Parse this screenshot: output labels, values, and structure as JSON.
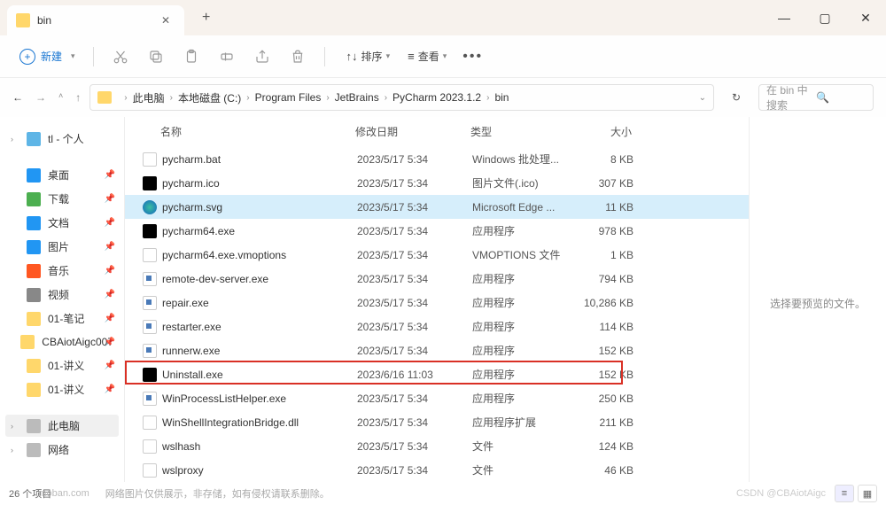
{
  "tab": {
    "title": "bin"
  },
  "toolbar": {
    "new_label": "新建",
    "sort_label": "排序",
    "view_label": "查看"
  },
  "breadcrumb": [
    "此电脑",
    "本地磁盘 (C:)",
    "Program Files",
    "JetBrains",
    "PyCharm 2023.1.2",
    "bin"
  ],
  "search": {
    "placeholder": "在 bin 中搜索"
  },
  "sidebar": {
    "cloud": "tl - 个人",
    "quick": [
      {
        "label": "桌面",
        "cls": "ic-desktop"
      },
      {
        "label": "下载",
        "cls": "ic-download"
      },
      {
        "label": "文档",
        "cls": "ic-docs"
      },
      {
        "label": "图片",
        "cls": "ic-pics"
      },
      {
        "label": "音乐",
        "cls": "ic-music"
      },
      {
        "label": "视频",
        "cls": "ic-video"
      },
      {
        "label": "01-笔记",
        "cls": "ic-folder"
      },
      {
        "label": "CBAiotAigc007",
        "cls": "ic-folder"
      },
      {
        "label": "01-讲义",
        "cls": "ic-folder"
      },
      {
        "label": "01-讲义",
        "cls": "ic-folder"
      }
    ],
    "pc": "此电脑",
    "net": "网络"
  },
  "columns": {
    "name": "名称",
    "date": "修改日期",
    "type": "类型",
    "size": "大小"
  },
  "files": [
    {
      "icon": "doc",
      "name": "pycharm.bat",
      "date": "2023/5/17 5:34",
      "type": "Windows 批处理...",
      "size": "8 KB"
    },
    {
      "icon": "pc",
      "name": "pycharm.ico",
      "date": "2023/5/17 5:34",
      "type": "图片文件(.ico)",
      "size": "307 KB"
    },
    {
      "icon": "edge",
      "name": "pycharm.svg",
      "date": "2023/5/17 5:34",
      "type": "Microsoft Edge ...",
      "size": "11 KB",
      "selected": true
    },
    {
      "icon": "pc",
      "name": "pycharm64.exe",
      "date": "2023/5/17 5:34",
      "type": "应用程序",
      "size": "978 KB"
    },
    {
      "icon": "doc",
      "name": "pycharm64.exe.vmoptions",
      "date": "2023/5/17 5:34",
      "type": "VMOPTIONS 文件",
      "size": "1 KB"
    },
    {
      "icon": "app",
      "name": "remote-dev-server.exe",
      "date": "2023/5/17 5:34",
      "type": "应用程序",
      "size": "794 KB"
    },
    {
      "icon": "app",
      "name": "repair.exe",
      "date": "2023/5/17 5:34",
      "type": "应用程序",
      "size": "10,286 KB"
    },
    {
      "icon": "app",
      "name": "restarter.exe",
      "date": "2023/5/17 5:34",
      "type": "应用程序",
      "size": "114 KB"
    },
    {
      "icon": "app",
      "name": "runnerw.exe",
      "date": "2023/5/17 5:34",
      "type": "应用程序",
      "size": "152 KB"
    },
    {
      "icon": "pc",
      "name": "Uninstall.exe",
      "date": "2023/6/16 11:03",
      "type": "应用程序",
      "size": "152 KB",
      "highlight": true
    },
    {
      "icon": "app",
      "name": "WinProcessListHelper.exe",
      "date": "2023/5/17 5:34",
      "type": "应用程序",
      "size": "250 KB"
    },
    {
      "icon": "doc",
      "name": "WinShellIntegrationBridge.dll",
      "date": "2023/5/17 5:34",
      "type": "应用程序扩展",
      "size": "211 KB"
    },
    {
      "icon": "doc",
      "name": "wslhash",
      "date": "2023/5/17 5:34",
      "type": "文件",
      "size": "124 KB"
    },
    {
      "icon": "doc",
      "name": "wslproxy",
      "date": "2023/5/17 5:34",
      "type": "文件",
      "size": "46 KB"
    }
  ],
  "preview": {
    "text": "选择要预览的文件。"
  },
  "status": {
    "count": "26 个项目",
    "watermark_suffix": "moban.com",
    "watermark_note": "网络图片仅供展示，非存储，如有侵权请联系删除。",
    "csdn": "CSDN @CBAiotAigc"
  }
}
